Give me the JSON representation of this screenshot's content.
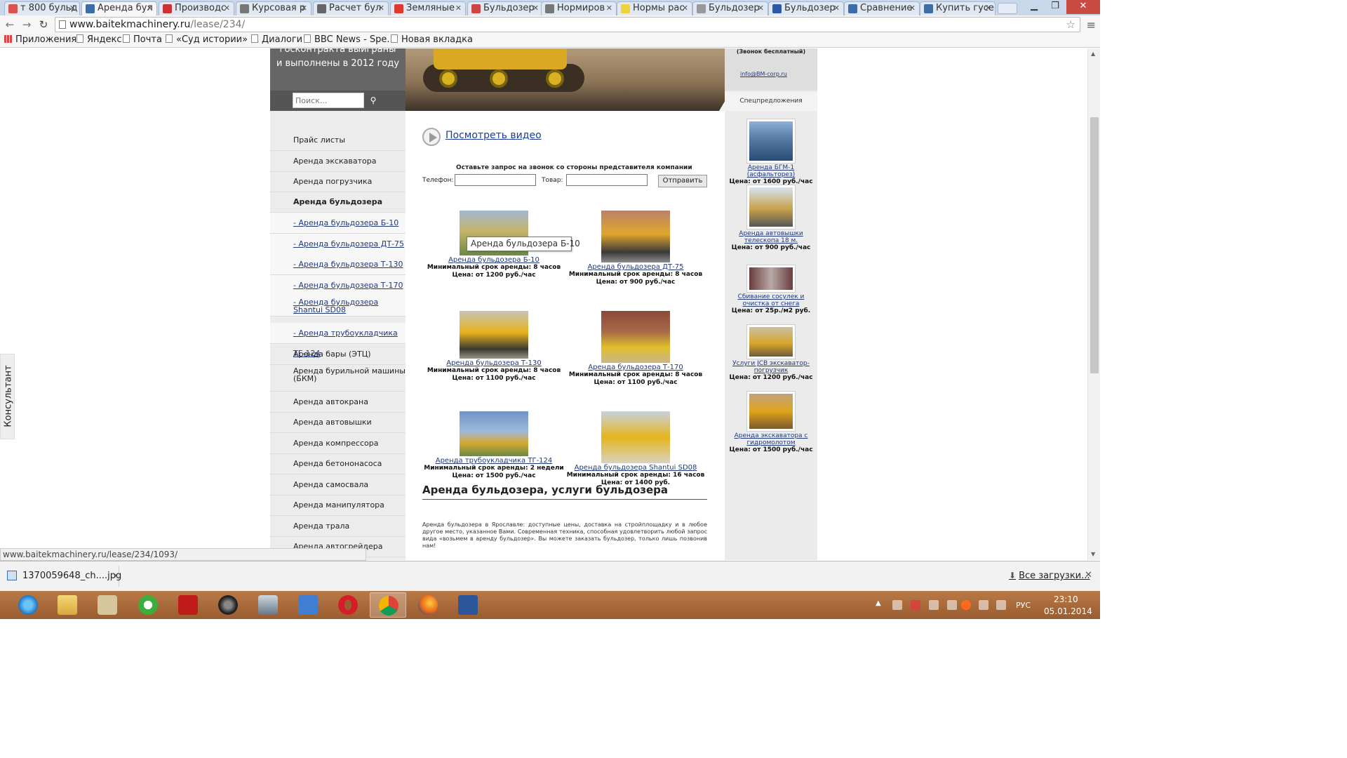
{
  "browser": {
    "tabs": [
      {
        "title": "т 800 бульд",
        "color": "#d9534f"
      },
      {
        "title": "Аренда бул",
        "color": "#3b6ea8",
        "active": true
      },
      {
        "title": "Производс",
        "color": "#c33"
      },
      {
        "title": "Курсовая р",
        "color": "#777"
      },
      {
        "title": "Расчет бул",
        "color": "#666"
      },
      {
        "title": "Земляные",
        "color": "#e03a2f"
      },
      {
        "title": "Бульдозер",
        "color": "#c44"
      },
      {
        "title": "Нормиров",
        "color": "#777"
      },
      {
        "title": "Нормы рас",
        "color": "#f0d23b"
      },
      {
        "title": "Бульдозер",
        "color": "#999"
      },
      {
        "title": "Бульдозер",
        "color": "#2b5aa8"
      },
      {
        "title": "Сравнение",
        "color": "#3b6ea8"
      },
      {
        "title": "Купить гусе",
        "color": "#3b6ea8"
      }
    ],
    "url_host": "www.baitekmachinery.ru",
    "url_path": "/lease/234/",
    "bookmarks": [
      "Приложения",
      "Яндекс",
      "Почта",
      "«Суд истории» ...",
      "Диалоги",
      "BBC News - Spe...",
      "Новая вкладка"
    ],
    "status_url": "www.baitekmachinery.ru/lease/234/1093/"
  },
  "site": {
    "promo_line1": "госконтракта выиграны",
    "promo_line2": "и выполнены в 2012 году",
    "search_placeholder": "Поиск...",
    "search_icon": "magnifier-icon",
    "contact_free": "(Звонок бесплатный)",
    "contact_email": "info@BM-corp.ru",
    "special_title": "Спецпредложения",
    "nav": [
      {
        "label": "Прайс листы"
      },
      {
        "label": "Аренда экскаватора"
      },
      {
        "label": "Аренда погрузчика"
      },
      {
        "label": "Аренда бульдозера",
        "bold": true
      },
      {
        "label": "- Аренда бульдозера Б-10",
        "sub": true
      },
      {
        "label": "- Аренда бульдозера ДТ-75",
        "sub": true
      },
      {
        "label": "- Аренда бульдозера Т-130",
        "sub": true
      },
      {
        "label": "- Аренда бульдозера Т-170",
        "sub": true
      },
      {
        "label": "- Аренда бульдозера Shantui SD08",
        "sub": true,
        "two": true
      },
      {
        "label": "- Аренда трубоукладчика ТГ-124",
        "sub": true
      },
      {
        "label": "Аренда бары (ЭТЦ)"
      },
      {
        "label": "Аренда бурильной машины (БКМ)",
        "two": true
      },
      {
        "label": "Аренда автокрана"
      },
      {
        "label": "Аренда автовышки"
      },
      {
        "label": "Аренда компрессора"
      },
      {
        "label": "Аренда бетононасоса"
      },
      {
        "label": "Аренда самосвала"
      },
      {
        "label": "Аренда манипулятора"
      },
      {
        "label": "Аренда трала"
      },
      {
        "label": "Аренда автогрейдера"
      }
    ],
    "video_link": "Посмотреть видео",
    "callform": {
      "title": "Оставьте запрос на звонок со стороны представителя компании",
      "phone_label": "Телефон:",
      "product_label": "Товар:",
      "send_label": "Отправить"
    },
    "products": [
      {
        "name": "Аренда бульдозера Б-10",
        "min": "Минимальный срок аренды: 8 часов",
        "price": "Цена: от 1200 руб./час"
      },
      {
        "name": "Аренда бульдозера ДТ-75",
        "min": "Минимальный срок аренды: 8 часов",
        "price": "Цена: от 900 руб./час"
      },
      {
        "name": "Аренда бульдозера Т-130",
        "min": "Минимальный срок аренды: 8 часов",
        "price": "Цена: от 1100 руб./час"
      },
      {
        "name": "Аренда бульдозера Т-170",
        "min": "Минимальный срок аренды: 8 часов",
        "price": "Цена: от 1100 руб./час"
      },
      {
        "name": "Аренда трубоукладчика ТГ-124",
        "min": "Минимальный срок аренды: 2 недели",
        "price": "Цена: от 1500 руб./час"
      },
      {
        "name": "Аренда бульдозера Shantui SD08",
        "min": "Минимальный срок аренды: 16 часов",
        "price": "Цена: от 1400 руб."
      }
    ],
    "tooltip": "Аренда бульдозера Б-10",
    "specials": [
      {
        "name": "Аренда БГМ-1 (асфальторез)",
        "price": "Цена: от 1600 руб./час"
      },
      {
        "name": "Аренда автовышки телескопа 18 м.",
        "price": "Цена: от 900 руб./час"
      },
      {
        "name": "Сбивание сосулек и очистка от снега",
        "price": "Цена: от 25р./м2 руб."
      },
      {
        "name": "Услуги JCB экскаватор-погрузчик",
        "price": "Цена: от 1200 руб./час"
      },
      {
        "name": "Аренда экскаватора с гидромолотом",
        "price": "Цена: от 1500 руб./час"
      }
    ],
    "article_title": "Аренда бульдозера, услуги бульдозера",
    "article_text": "Аренда бульдозера в Ярославле: доступные цены, доставка на стройплощадку и в любое другое место, указанное Вами. Современная техника, способная удовлетворить любой запрос вида «возьмем в аренду бульдозер». Вы можете заказать бульдозер, только лишь позвонив нам!",
    "consultant": "Консультант"
  },
  "shelf": {
    "download_name": "1370059648_ch....jpg",
    "all_downloads": "Все загрузки..."
  },
  "taskbar": {
    "lang": "РУС",
    "time": "23:10",
    "date": "05.01.2014"
  }
}
